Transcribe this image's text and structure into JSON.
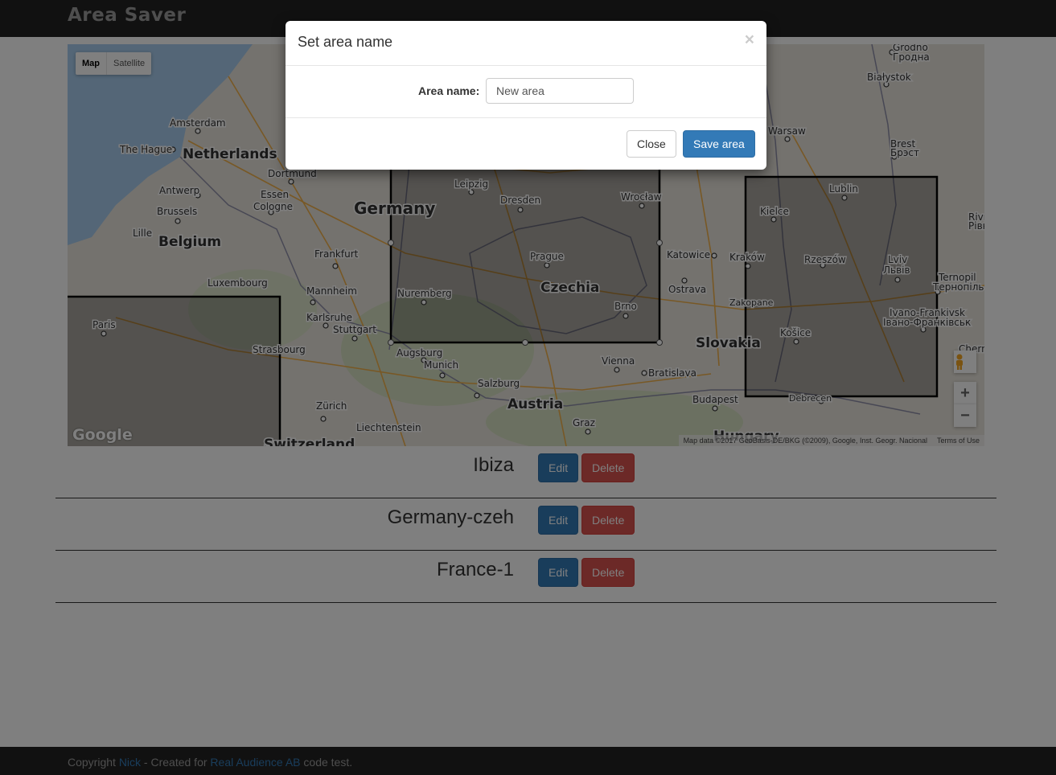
{
  "app": {
    "brand": "Area Saver"
  },
  "map": {
    "type_controls": {
      "map_label": "Map",
      "satellite_label": "Satellite"
    },
    "zoom_in": "+",
    "zoom_out": "−",
    "logo": "Google",
    "attribution": "Map data ©2017 GeoBasis-DE/BKG (©2009), Google, Inst. Geogr. Nacional",
    "terms": "Terms of Use",
    "labels": {
      "grodno": "Grodno",
      "grodno_ru": "Гродна",
      "bialystok": "Białystok",
      "amsterdam": "Amsterdam",
      "the_hague": "The Hague",
      "netherlands": "Netherlands",
      "warsaw": "Warsaw",
      "brest": "Brest",
      "brest_ru": "Брэст",
      "dortmund": "Dortmund",
      "leipzig": "Leipzig",
      "dresden": "Dresden",
      "wroclaw": "Wrocław",
      "lublin": "Lublin",
      "antwerp": "Antwerp",
      "essen": "Essen",
      "cologne": "Cologne",
      "germany": "Germany",
      "brussels": "Brussels",
      "kielce": "Kielce",
      "rivne": "Rivn",
      "rivne_ru": "Рівн",
      "lille": "Lille",
      "belgium": "Belgium",
      "frankfurt": "Frankfurt",
      "prague": "Prague",
      "katowice": "Katowice",
      "krakow": "Kraków",
      "rzeszow": "Rzeszów",
      "lviv": "Lviv",
      "lviv_ru": "Львів",
      "czechia": "Czechia",
      "ternopil": "Ternopil",
      "ternopil_ru": "Тернопіль",
      "luxembourg": "Luxembourg",
      "mannheim": "Mannheim",
      "nuremberg": "Nuremberg",
      "ostrava": "Ostrava",
      "zakopane": "Zakopane",
      "karlsruhe": "Karlsruhe",
      "brno": "Brno",
      "ivano": "Ivano-Frankivsk",
      "ivano_ru": "Івано-Франківськ",
      "paris": "Paris",
      "stuttgart": "Stuttgart",
      "kosice": "Košice",
      "strasbourg": "Strasbourg",
      "augsburg": "Augsburg",
      "slovakia": "Slovakia",
      "chernivtsi": "Chernivts",
      "munich": "Munich",
      "vienna": "Vienna",
      "bratislava": "Bratislava",
      "salzburg": "Salzburg",
      "austria": "Austria",
      "budapest": "Budapest",
      "debrecen": "Debrecen",
      "zurich": "Zürich",
      "liechtenstein": "Liechtenstein",
      "graz": "Graz",
      "switzerland": "Switzerland",
      "hungary": "Hungary"
    }
  },
  "areas": [
    {
      "name": "Ibiza",
      "edit_label": "Edit",
      "delete_label": "Delete"
    },
    {
      "name": "Germany-czeh",
      "edit_label": "Edit",
      "delete_label": "Delete"
    },
    {
      "name": "France-1",
      "edit_label": "Edit",
      "delete_label": "Delete"
    }
  ],
  "footer": {
    "prefix": "Copyright ",
    "author": "Nick",
    "middle": " - Created for ",
    "company": "Real Audience AB",
    "suffix": " code test."
  },
  "modal": {
    "title": "Set area name",
    "close_x": "×",
    "field_label": "Area name:",
    "field_value": "New area",
    "close_label": "Close",
    "save_label": "Save area"
  },
  "colors": {
    "primary": "#337ab7",
    "danger": "#d9534f",
    "navbar": "#222222"
  }
}
